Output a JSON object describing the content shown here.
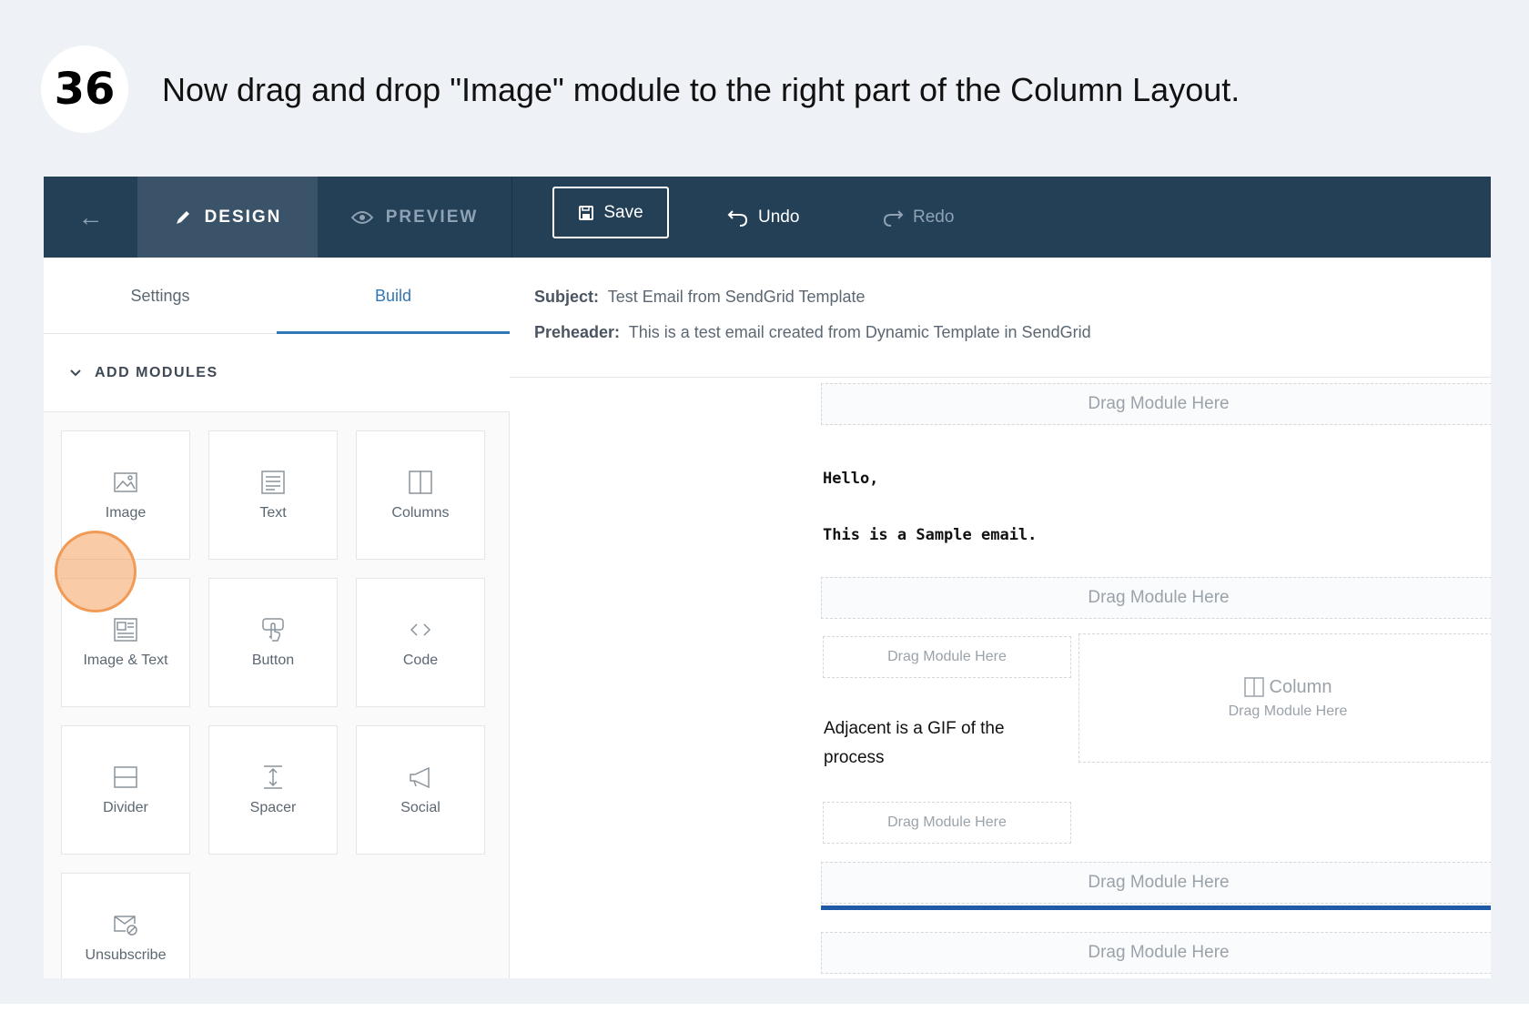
{
  "step": {
    "number": "36",
    "instruction": "Now drag and drop \"Image\" module to the right part of the Column Layout."
  },
  "toolbar": {
    "design_label": "DESIGN",
    "preview_label": "PREVIEW",
    "save_label": "Save",
    "undo_label": "Undo",
    "redo_label": "Redo"
  },
  "left_panel": {
    "tabs": [
      "Settings",
      "Build"
    ],
    "active_tab": "Build",
    "section_title": "ADD MODULES",
    "modules": [
      "Image",
      "Text",
      "Columns",
      "Image & Text",
      "Button",
      "Code",
      "Divider",
      "Spacer",
      "Social",
      "Unsubscribe"
    ]
  },
  "email": {
    "subject_label": "Subject:",
    "subject_value": "Test Email from SendGrid Template",
    "preheader_label": "Preheader:",
    "preheader_value": "This is a test email created from Dynamic Template in SendGrid",
    "drop_label": "Drag Module Here",
    "greeting": "Hello,",
    "body_line": "This is a Sample email.",
    "gif_text": "Adjacent is a GIF of the process",
    "column_title": "Column",
    "column_sub": "Drag Module Here"
  },
  "colors": {
    "topbar": "#244057",
    "active_tab": "#2f77b5",
    "drop_indicator": "#1e5aa8",
    "cursor_highlight": "#f5a05f"
  }
}
